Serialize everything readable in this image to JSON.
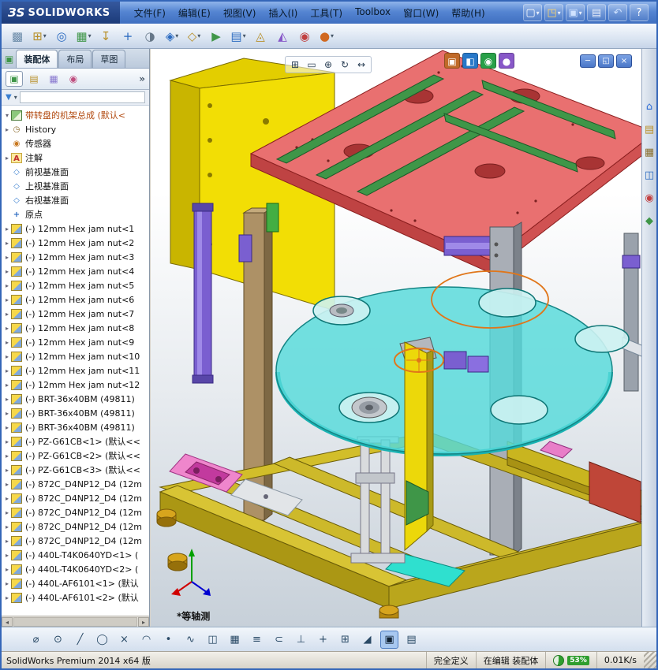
{
  "titlebar": {
    "logo_prefix": "ЗS",
    "logo_name": "SOLIDWORKS",
    "menus": [
      "文件(F)",
      "编辑(E)",
      "视图(V)",
      "插入(I)",
      "工具(T)",
      "Toolbox",
      "窗口(W)",
      "帮助(H)"
    ],
    "icons": [
      {
        "n": "new-document-button",
        "g": "▢",
        "c": "#ffffff",
        "dd": "dd"
      },
      {
        "n": "open-document-button",
        "g": "◳",
        "c": "#ffd666",
        "dd": "dd"
      },
      {
        "n": "save-button",
        "g": "▣",
        "c": "#cfe2ff",
        "dd": "dd"
      },
      {
        "n": "print-button",
        "g": "▤",
        "c": "#e8eef8"
      },
      {
        "n": "undo-button",
        "g": "↶",
        "c": "#cfe2ff"
      },
      {
        "n": "help-button",
        "g": "?",
        "c": "#ffffff"
      }
    ]
  },
  "toolbar": {
    "icons": [
      {
        "n": "edit-component-button",
        "g": "▩",
        "c": "#6a8aa8"
      },
      {
        "n": "insert-components-button",
        "g": "⊞",
        "c": "#b8902a",
        "dd": "dd"
      },
      {
        "n": "mate-button",
        "g": "◎",
        "c": "#2a6ac0"
      },
      {
        "n": "linear-component-pattern-button",
        "g": "▦",
        "c": "#3f9648",
        "dd": "dd"
      },
      {
        "n": "smart-fasteners-button",
        "g": "↧",
        "c": "#b8902a"
      },
      {
        "n": "move-component-button",
        "g": "+",
        "c": "#2a6ac0"
      },
      {
        "n": "show-hidden-components-button",
        "g": "◑",
        "c": "#667788"
      },
      {
        "n": "assembly-features-button",
        "g": "◈",
        "c": "#2a6ac0",
        "dd": "dd"
      },
      {
        "n": "reference-geometry-button",
        "g": "◇",
        "c": "#b8902a",
        "dd": "dd"
      },
      {
        "n": "new-motion-study-button",
        "g": "▶",
        "c": "#3f9648"
      },
      {
        "n": "bill-of-materials-button",
        "g": "▤",
        "c": "#2a6ac0",
        "dd": "dd"
      },
      {
        "n": "exploded-view-button",
        "g": "◬",
        "c": "#b8902a"
      },
      {
        "n": "instant3d-button",
        "g": "◭",
        "c": "#8858c8"
      },
      {
        "n": "interference-detection-button",
        "g": "◉",
        "c": "#c04040"
      },
      {
        "n": "appearance-button",
        "g": "●",
        "c": "#d06820",
        "dd": "dd"
      }
    ]
  },
  "tabs": [
    {
      "n": "tab-assembly",
      "label": "装配体",
      "cls": "active"
    },
    {
      "n": "tab-layout",
      "label": "布局"
    },
    {
      "n": "tab-sketch",
      "label": "草图"
    }
  ],
  "panel": {
    "tabs": [
      {
        "n": "featuremanager-tree-tab",
        "g": "▣",
        "c": "#3f9648",
        "cls": "active"
      },
      {
        "n": "propertymanager-tab",
        "g": "▤",
        "c": "#b8902a"
      },
      {
        "n": "configurationmanager-tab",
        "g": "▦",
        "c": "#8a7ad0"
      },
      {
        "n": "displaymanager-tab",
        "g": "◉",
        "c": "#c05080"
      }
    ],
    "chevron": "»",
    "filter_value": ""
  },
  "tree": {
    "root": {
      "t": "asm",
      "label": "带转盘的机架总成 (默认<"
    },
    "items": [
      {
        "t": "hist",
        "label": "History"
      },
      {
        "t": "sensor",
        "label": "传感器"
      },
      {
        "t": "ann",
        "label": "注解"
      },
      {
        "t": "plane",
        "label": "前视基准面"
      },
      {
        "t": "plane",
        "label": "上视基准面"
      },
      {
        "t": "plane",
        "label": "右视基准面"
      },
      {
        "t": "origin",
        "label": "原点"
      },
      {
        "t": "part",
        "label": "(-) 12mm Hex jam nut<1"
      },
      {
        "t": "part",
        "label": "(-) 12mm Hex jam nut<2"
      },
      {
        "t": "part",
        "label": "(-) 12mm Hex jam nut<3"
      },
      {
        "t": "part",
        "label": "(-) 12mm Hex jam nut<4"
      },
      {
        "t": "part",
        "label": "(-) 12mm Hex jam nut<5"
      },
      {
        "t": "part",
        "label": "(-) 12mm Hex jam nut<6"
      },
      {
        "t": "part",
        "label": "(-) 12mm Hex jam nut<7"
      },
      {
        "t": "part",
        "label": "(-) 12mm Hex jam nut<8"
      },
      {
        "t": "part",
        "label": "(-) 12mm Hex jam nut<9"
      },
      {
        "t": "part",
        "label": "(-) 12mm Hex jam nut<10"
      },
      {
        "t": "part",
        "label": "(-) 12mm Hex jam nut<11"
      },
      {
        "t": "part",
        "label": "(-) 12mm Hex jam nut<12"
      },
      {
        "t": "part",
        "label": "(-) BRT-36x40BM (49811)"
      },
      {
        "t": "part",
        "label": "(-) BRT-36x40BM (49811)"
      },
      {
        "t": "part",
        "label": "(-) BRT-36x40BM (49811)"
      },
      {
        "t": "part",
        "label": "(-) PZ-G61CB<1> (默认<<"
      },
      {
        "t": "part",
        "label": "(-) PZ-G61CB<2> (默认<<"
      },
      {
        "t": "part",
        "label": "(-) PZ-G61CB<3> (默认<<"
      },
      {
        "t": "part",
        "label": "(-) 872C_D4NP12_D4 (12m"
      },
      {
        "t": "part",
        "label": "(-) 872C_D4NP12_D4 (12m"
      },
      {
        "t": "part",
        "label": "(-) 872C_D4NP12_D4 (12m"
      },
      {
        "t": "part",
        "label": "(-) 872C_D4NP12_D4 (12m"
      },
      {
        "t": "part",
        "label": "(-) 872C_D4NP12_D4 (12m"
      },
      {
        "t": "part",
        "label": "(-) 440L-T4K0640YD<1> ("
      },
      {
        "t": "part",
        "label": "(-) 440L-T4K0640YD<2> ("
      },
      {
        "t": "part",
        "label": "(-) 440L-AF6101<1> (默认"
      },
      {
        "t": "part",
        "label": "(-) 440L-AF6101<2> (默认"
      }
    ]
  },
  "viewport": {
    "view_label": "*等轴测",
    "zoom_tools": [
      {
        "n": "zoom-to-fit-button",
        "g": "⊞"
      },
      {
        "n": "zoom-to-area-button",
        "g": "▭"
      },
      {
        "n": "zoom-in-out-button",
        "g": "⊕"
      },
      {
        "n": "rotate-view-button",
        "g": "↻"
      },
      {
        "n": "pan-button",
        "g": "↔"
      }
    ],
    "view_tools": [
      {
        "n": "view-orientation-button",
        "g": "▣",
        "c": "#c06a28"
      },
      {
        "n": "display-style-button",
        "g": "◧",
        "c": "#2878c8"
      },
      {
        "n": "hide-show-items-button",
        "g": "◉",
        "c": "#28a048"
      },
      {
        "n": "edit-appearance-button",
        "g": "●",
        "c": "#8858c8"
      }
    ],
    "window_buttons": [
      {
        "n": "doc-minimize-button",
        "g": "─"
      },
      {
        "n": "doc-restore-button",
        "g": "◱"
      },
      {
        "n": "doc-close-button",
        "g": "×"
      }
    ]
  },
  "taskpane": {
    "tabs": [
      {
        "n": "solidworks-resources-tab",
        "g": "⌂",
        "c": "#2a6ad4"
      },
      {
        "n": "design-library-tab",
        "g": "▤",
        "c": "#b8902a"
      },
      {
        "n": "file-explorer-tab",
        "g": "▦",
        "c": "#8a7030"
      },
      {
        "n": "view-palette-tab",
        "g": "◫",
        "c": "#2a6ac0"
      },
      {
        "n": "appearances-scenes-tab",
        "g": "◉",
        "c": "#c34040"
      },
      {
        "n": "custom-properties-tab",
        "g": "◆",
        "c": "#3f9648"
      }
    ]
  },
  "sketchbar": {
    "tools": [
      {
        "n": "smart-dimension-button",
        "g": "⌀"
      },
      {
        "n": "circle-tool-button",
        "g": "⊙"
      },
      {
        "n": "line-tool-button",
        "g": "╱"
      },
      {
        "n": "ellipse-tool-button",
        "g": "◯"
      },
      {
        "n": "trim-entities-button",
        "g": "×"
      },
      {
        "n": "arc-tool-button",
        "g": "◠"
      },
      {
        "n": "point-tool-button",
        "g": "•"
      },
      {
        "n": "spline-tool-button",
        "g": "∿"
      },
      {
        "n": "mirror-entities-button",
        "g": "◫"
      },
      {
        "n": "linear-sketch-pattern-button",
        "g": "▦"
      },
      {
        "n": "offset-entities-button",
        "g": "≡"
      },
      {
        "n": "convert-entities-button",
        "g": "⊂"
      },
      {
        "n": "display-relations-button",
        "g": "⊥"
      },
      {
        "n": "quick-snaps-button",
        "g": "+"
      },
      {
        "n": "grid-settings-button",
        "g": "⊞"
      },
      {
        "n": "shaded-sketch-contours-button",
        "g": "◢"
      },
      {
        "n": "large-assembly-mode-button",
        "g": "▣",
        "cls": "active"
      },
      {
        "n": "selection-filter-button",
        "g": "▤"
      }
    ]
  },
  "statusbar": {
    "app_version": "SolidWorks Premium 2014 x64 版",
    "definition_status": "完全定义",
    "editing_status": "在编辑 装配体",
    "resource_gauge": "53%",
    "network_speed": "0.01K/s"
  }
}
